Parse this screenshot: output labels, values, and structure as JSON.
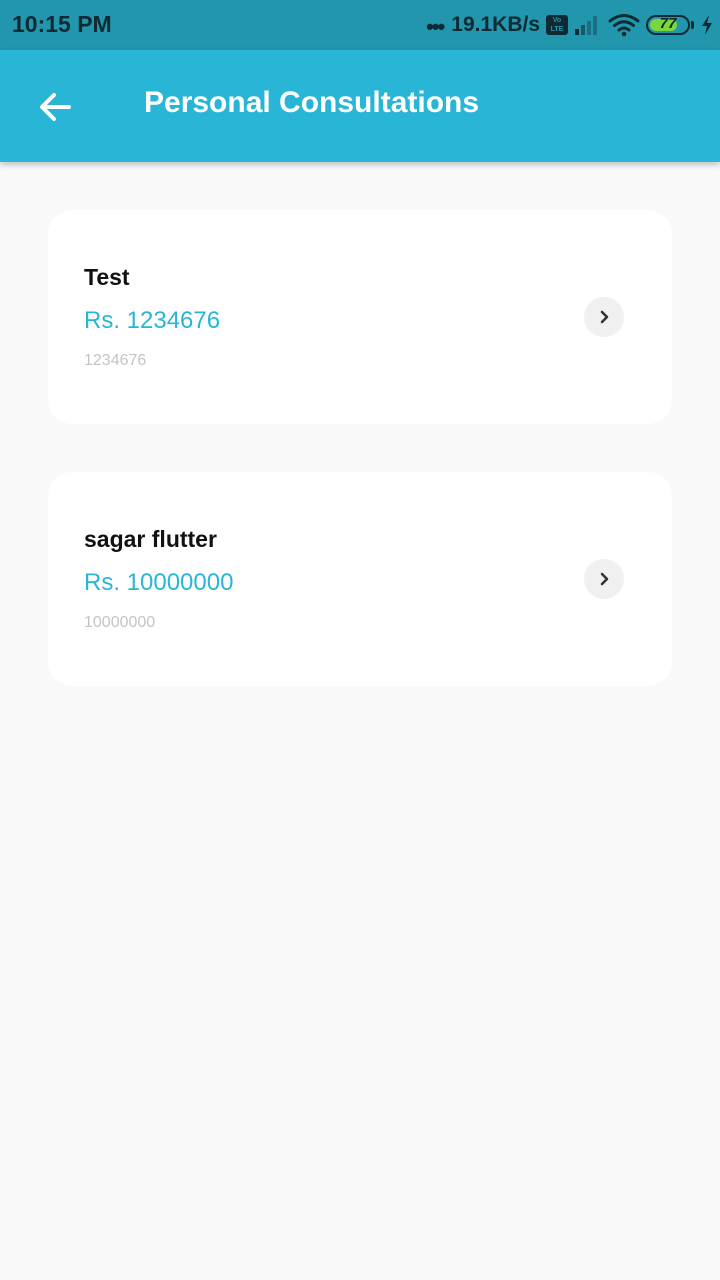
{
  "status_bar": {
    "time": "10:15 PM",
    "dots": "•••",
    "network_speed": "19.1KB/s",
    "volte_top": "Vo",
    "volte_bottom": "LTE",
    "battery_level": "77",
    "battery_fraction": 0.77,
    "background_color": "#2196ad"
  },
  "app_bar": {
    "title": "Personal Consultations",
    "background_color": "#29b6d6",
    "back_icon": "arrow-back-icon"
  },
  "consultations": [
    {
      "name": "Test",
      "price": "Rs. 1234676",
      "detail": "1234676"
    },
    {
      "name": "sagar flutter",
      "price": "Rs. 10000000",
      "detail": "10000000"
    }
  ],
  "colors": {
    "accent": "#29b6d6",
    "page_background": "#f9f9f9",
    "card_background": "#ffffff",
    "muted_text": "#c4c4c4"
  }
}
